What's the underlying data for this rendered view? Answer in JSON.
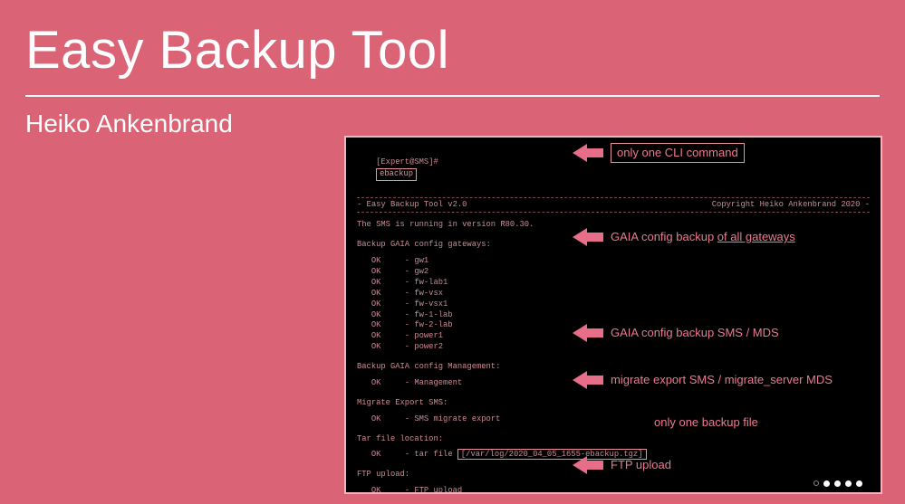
{
  "title": "Easy Backup Tool",
  "author": "Heiko Ankenbrand",
  "terminal": {
    "prompt": "[Expert@SMS]#",
    "command": "ebackup",
    "header_left": "- Easy Backup Tool v2.0",
    "header_right": "Copyright Heiko Ankenbrand 2020 -",
    "sms_line": "The SMS is running in version R80.30.",
    "sec_gaia_gw": "Backup GAIA config gateways:",
    "gw_rows": [
      {
        "s": "OK",
        "n": "- gw1"
      },
      {
        "s": "OK",
        "n": "- gw2"
      },
      {
        "s": "OK",
        "n": "- fw-lab1"
      },
      {
        "s": "OK",
        "n": "- fw-vsx"
      },
      {
        "s": "OK",
        "n": "- fw-vsx1"
      },
      {
        "s": "OK",
        "n": "- fw-1-lab"
      },
      {
        "s": "OK",
        "n": "- fw-2-lab"
      },
      {
        "s": "OK",
        "n": "- power1"
      },
      {
        "s": "OK",
        "n": "- power2"
      }
    ],
    "sec_gaia_mgmt": "Backup GAIA config Management:",
    "mgmt_row_s": "OK",
    "mgmt_row_n": "- Management",
    "sec_migrate": "Migrate Export SMS:",
    "migrate_row_s": "OK",
    "migrate_row_n": "- SMS migrate export",
    "sec_tar": "Tar file location:",
    "tar_row_s": "OK",
    "tar_row_prefix": "- tar file ",
    "tar_path": "[/var/log/2020_04_05_1655-ebackup.tgz]",
    "sec_ftp": "FTP upload:",
    "ftp_row_s": "OK",
    "ftp_row_n": "- FTP upload"
  },
  "notes": {
    "cli": "only one CLI command",
    "gaia_gw_a": "GAIA config backup ",
    "gaia_gw_b": "of all gateways",
    "gaia_mgmt": "GAIA config backup SMS / MDS",
    "migrate": "migrate export SMS  / migrate_server MDS",
    "onefile": "only one backup file",
    "ftp": "FTP upload"
  }
}
